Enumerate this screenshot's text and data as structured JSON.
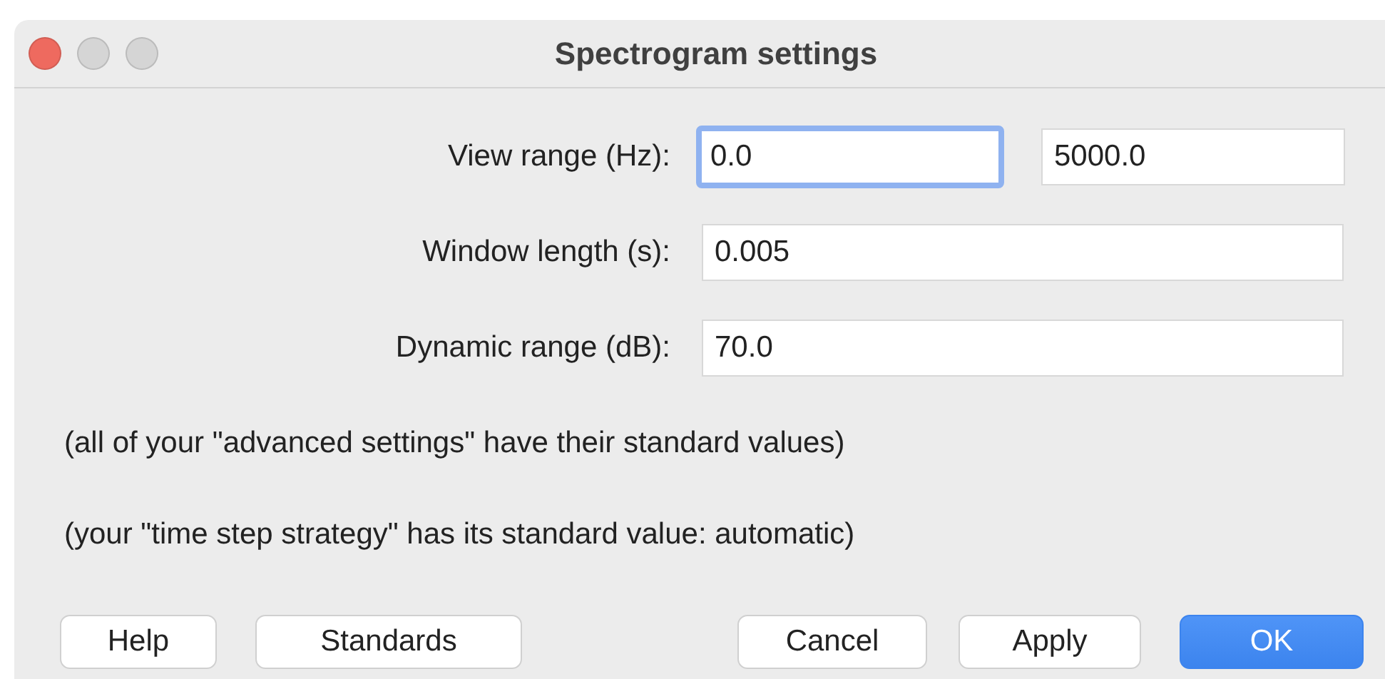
{
  "window": {
    "title": "Spectrogram settings",
    "traffic_lights": [
      {
        "kind": "close"
      },
      {
        "kind": "minimize"
      },
      {
        "kind": "zoom"
      }
    ]
  },
  "fields": [
    {
      "label": "View range (Hz):",
      "inputs": [
        {
          "value": "0.0",
          "focused": true
        },
        {
          "value": "5000.0",
          "focused": false
        }
      ]
    },
    {
      "label": "Window length (s):",
      "inputs": [
        {
          "value": "0.005",
          "focused": false
        }
      ]
    },
    {
      "label": "Dynamic range (dB):",
      "inputs": [
        {
          "value": "70.0",
          "focused": false
        }
      ]
    }
  ],
  "notes": [
    "(all of your \"advanced settings\" have their standard values)",
    "(your \"time step strategy\" has its standard value: automatic)"
  ],
  "buttons": [
    {
      "label": "Help",
      "default": false
    },
    {
      "label": "Standards",
      "default": false
    },
    {
      "label": "Cancel",
      "default": false
    },
    {
      "label": "Apply",
      "default": false
    },
    {
      "label": "OK",
      "default": true
    }
  ]
}
